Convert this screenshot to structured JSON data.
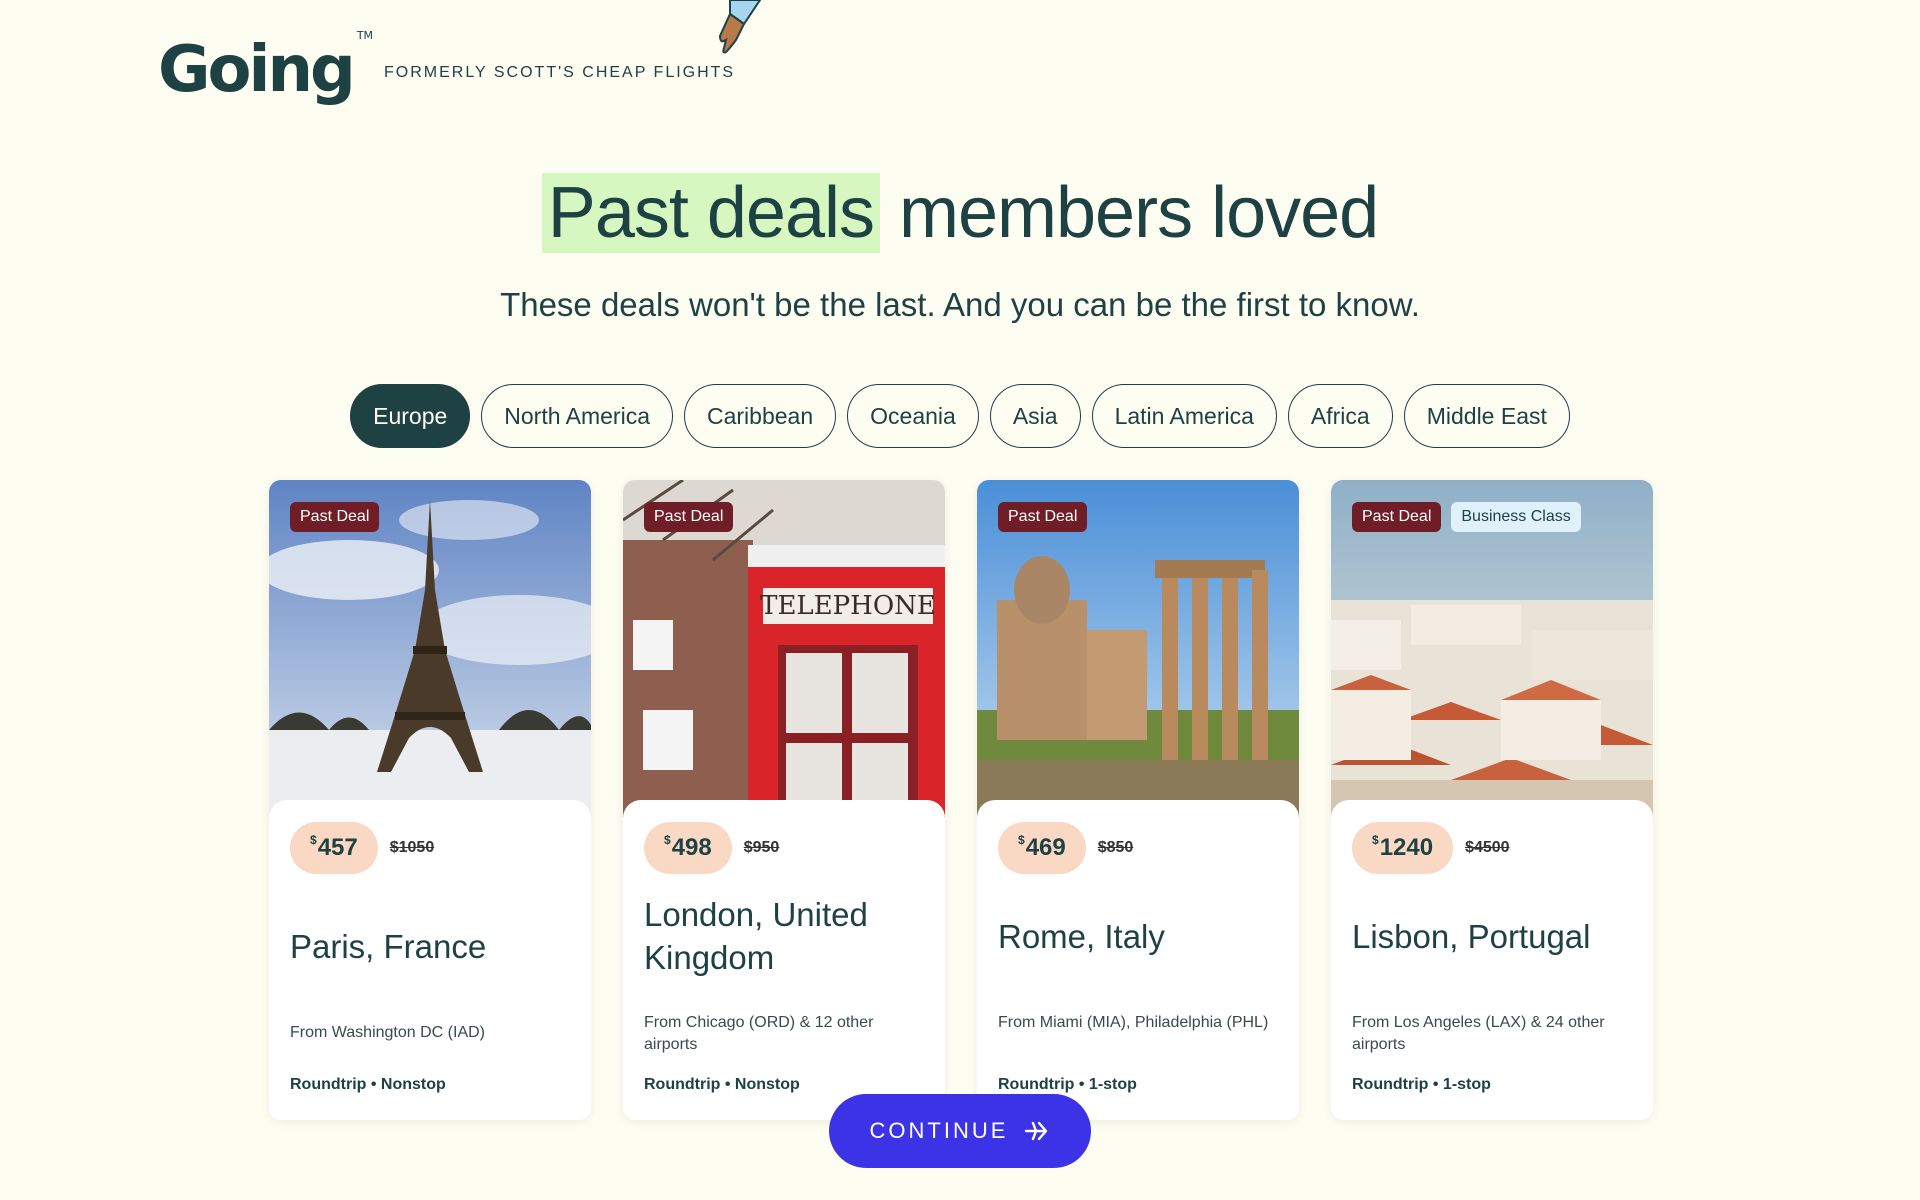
{
  "header": {
    "logo": "Going",
    "logo_tm": "TM",
    "tagline": "FORMERLY SCOTT'S CHEAP FLIGHTS"
  },
  "hero": {
    "title_highlight": "Past deals",
    "title_rest": " members loved",
    "subtitle": "These deals won't be the last. And you can be the first to know."
  },
  "tabs": [
    {
      "label": "Europe",
      "active": true
    },
    {
      "label": "North America",
      "active": false
    },
    {
      "label": "Caribbean",
      "active": false
    },
    {
      "label": "Oceania",
      "active": false
    },
    {
      "label": "Asia",
      "active": false
    },
    {
      "label": "Latin America",
      "active": false
    },
    {
      "label": "Africa",
      "active": false
    },
    {
      "label": "Middle East",
      "active": false
    }
  ],
  "cards": [
    {
      "badge": "Past Deal",
      "extra_badge": "",
      "currency": "$",
      "price": "457",
      "old_price": "$1050",
      "city": "Paris, France",
      "from": "From Washington DC (IAD)",
      "trip": "Roundtrip • Nonstop"
    },
    {
      "badge": "Past Deal",
      "extra_badge": "",
      "currency": "$",
      "price": "498",
      "old_price": "$950",
      "city": "London, United Kingdom",
      "from": "From Chicago (ORD) & 12 other airports",
      "trip": "Roundtrip • Nonstop",
      "photo_text": "TELEPHONE"
    },
    {
      "badge": "Past Deal",
      "extra_badge": "",
      "currency": "$",
      "price": "469",
      "old_price": "$850",
      "city": "Rome, Italy",
      "from": "From Miami (MIA), Philadelphia (PHL)",
      "trip": "Roundtrip • 1-stop"
    },
    {
      "badge": "Past Deal",
      "extra_badge": "Business Class",
      "currency": "$",
      "price": "1240",
      "old_price": "$4500",
      "city": "Lisbon, Portugal",
      "from": "From Los Angeles (LAX) & 24 other airports",
      "trip": "Roundtrip • 1-stop"
    }
  ],
  "continue_label": "CONTINUE",
  "colors": {
    "brand": "#1e4144",
    "accent": "#3d33e6",
    "deal_badge": "#6f1e28",
    "price_pill": "#f9d8c4",
    "highlight": "#d6f7c0"
  }
}
